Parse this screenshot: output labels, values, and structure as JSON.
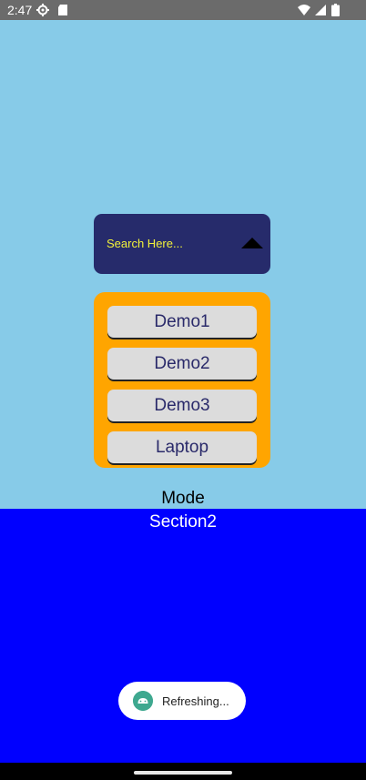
{
  "status_bar": {
    "time": "2:47",
    "icons": [
      "settings-gear-icon",
      "sd-card-icon",
      "wifi-icon",
      "signal-icon",
      "battery-icon"
    ]
  },
  "search": {
    "placeholder": "Search Here..."
  },
  "list": {
    "items": [
      "Demo1",
      "Demo2",
      "Demo3",
      "Laptop"
    ]
  },
  "labels": {
    "mode": "Mode",
    "section2": "Section2"
  },
  "toast": {
    "text": "Refreshing..."
  },
  "colors": {
    "section1_bg": "#87cbe8",
    "section2_bg": "#0000ff",
    "search_bg": "#262b6b",
    "search_text": "#f2f23a",
    "list_panel_bg": "#ffa500",
    "list_item_bg": "#dcdcdc"
  }
}
